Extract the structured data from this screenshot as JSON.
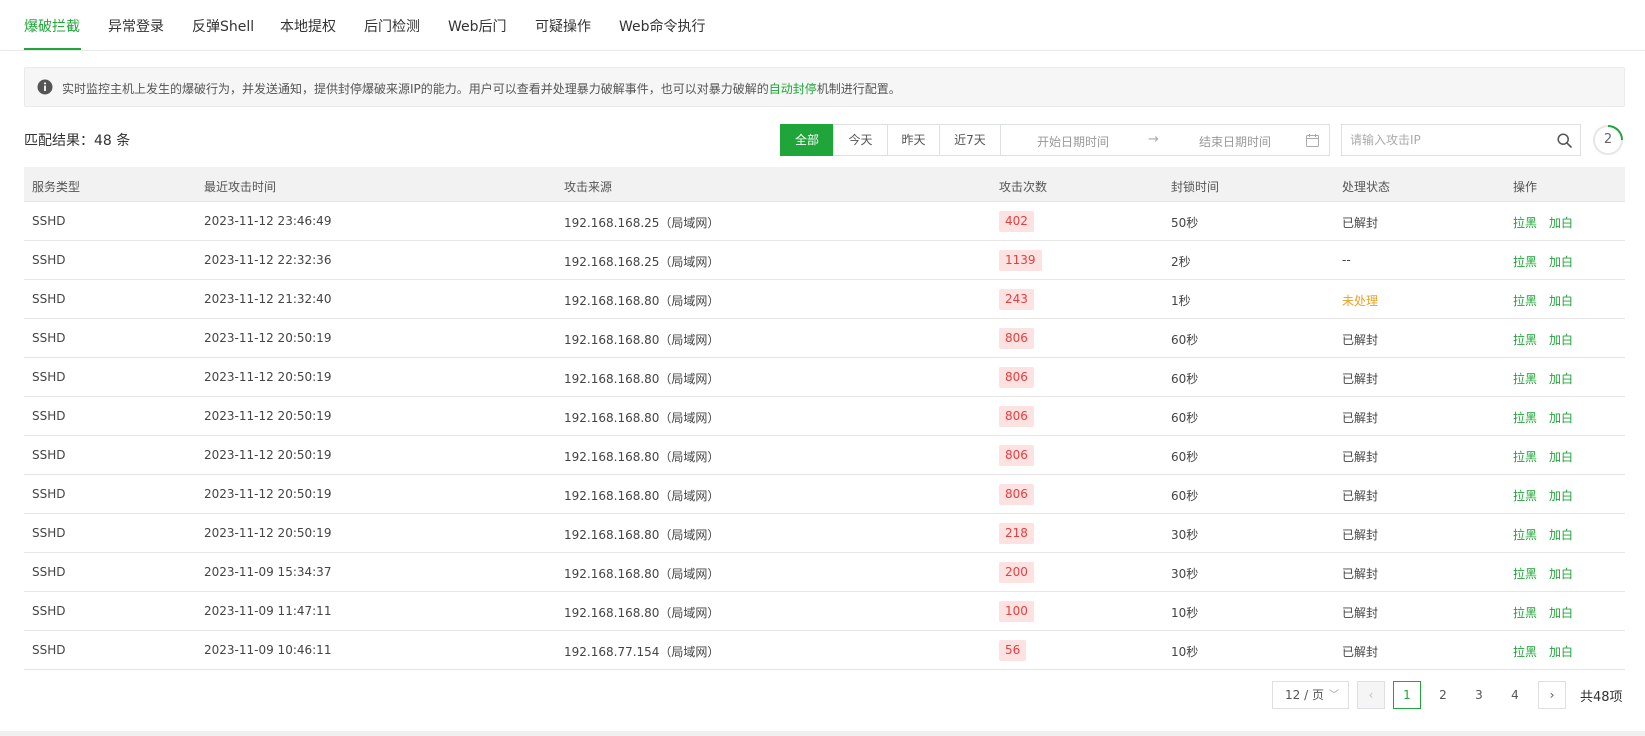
{
  "tabs": [
    {
      "label": "爆破拦截",
      "active": true
    },
    {
      "label": "异常登录",
      "active": false
    },
    {
      "label": "反弹Shell",
      "active": false
    },
    {
      "label": "本地提权",
      "active": false
    },
    {
      "label": "后门检测",
      "active": false
    },
    {
      "label": "Web后门",
      "active": false
    },
    {
      "label": "可疑操作",
      "active": false
    },
    {
      "label": "Web命令执行",
      "active": false
    }
  ],
  "info": {
    "text_before": "实时监控主机上发生的爆破行为，并发送通知，提供封停爆破来源IP的能力。用户可以查看并处理暴力破解事件，也可以对暴力破解的",
    "link": "自动封停",
    "text_after": "机制进行配置。"
  },
  "toolbar": {
    "match_result": "匹配结果：48 条",
    "ranges": [
      "全部",
      "今天",
      "昨天",
      "近7天"
    ],
    "active_range": "全部",
    "date_start_placeholder": "开始日期时间",
    "date_arrow": "→",
    "date_end_placeholder": "结束日期时间",
    "search_placeholder": "请输入攻击IP",
    "refresh_count": "2"
  },
  "table": {
    "headers": [
      "服务类型",
      "最近攻击时间",
      "攻击来源",
      "攻击次数",
      "封锁时间",
      "处理状态",
      "操作"
    ],
    "rows": [
      {
        "service": "SSHD",
        "time": "2023-11-12 23:46:49",
        "source": "192.168.168.25（局域网）",
        "count": "402",
        "block": "50秒",
        "status": "已解封"
      },
      {
        "service": "SSHD",
        "time": "2023-11-12 22:32:36",
        "source": "192.168.168.25（局域网）",
        "count": "1139",
        "block": "2秒",
        "status": "--"
      },
      {
        "service": "SSHD",
        "time": "2023-11-12 21:32:40",
        "source": "192.168.168.80（局域网）",
        "count": "243",
        "block": "1秒",
        "status": "未处理"
      },
      {
        "service": "SSHD",
        "time": "2023-11-12 20:50:19",
        "source": "192.168.168.80（局域网）",
        "count": "806",
        "block": "60秒",
        "status": "已解封"
      },
      {
        "service": "SSHD",
        "time": "2023-11-12 20:50:19",
        "source": "192.168.168.80（局域网）",
        "count": "806",
        "block": "60秒",
        "status": "已解封"
      },
      {
        "service": "SSHD",
        "time": "2023-11-12 20:50:19",
        "source": "192.168.168.80（局域网）",
        "count": "806",
        "block": "60秒",
        "status": "已解封"
      },
      {
        "service": "SSHD",
        "time": "2023-11-12 20:50:19",
        "source": "192.168.168.80（局域网）",
        "count": "806",
        "block": "60秒",
        "status": "已解封"
      },
      {
        "service": "SSHD",
        "time": "2023-11-12 20:50:19",
        "source": "192.168.168.80（局域网）",
        "count": "806",
        "block": "60秒",
        "status": "已解封"
      },
      {
        "service": "SSHD",
        "time": "2023-11-12 20:50:19",
        "source": "192.168.168.80（局域网）",
        "count": "218",
        "block": "30秒",
        "status": "已解封"
      },
      {
        "service": "SSHD",
        "time": "2023-11-09 15:34:37",
        "source": "192.168.168.80（局域网）",
        "count": "200",
        "block": "30秒",
        "status": "已解封"
      },
      {
        "service": "SSHD",
        "time": "2023-11-09 11:47:11",
        "source": "192.168.168.80（局域网）",
        "count": "100",
        "block": "10秒",
        "status": "已解封"
      },
      {
        "service": "SSHD",
        "time": "2023-11-09 10:46:11",
        "source": "192.168.77.154（局域网）",
        "count": "56",
        "block": "10秒",
        "status": "已解封"
      }
    ],
    "actions": {
      "blacklist": "拉黑",
      "whitelist": "加白"
    }
  },
  "pagination": {
    "page_size": "12 / 页",
    "page_size_chevron": "﹀",
    "prev": "‹",
    "next": "›",
    "pages": [
      "1",
      "2",
      "3",
      "4"
    ],
    "current_page": "1",
    "total": "共48项"
  },
  "colors": {
    "accent": "#20a53a",
    "count_badge_bg": "#fde2e2",
    "count_badge_text": "#e53e3e",
    "status_unprocessed": "#f0a020"
  }
}
